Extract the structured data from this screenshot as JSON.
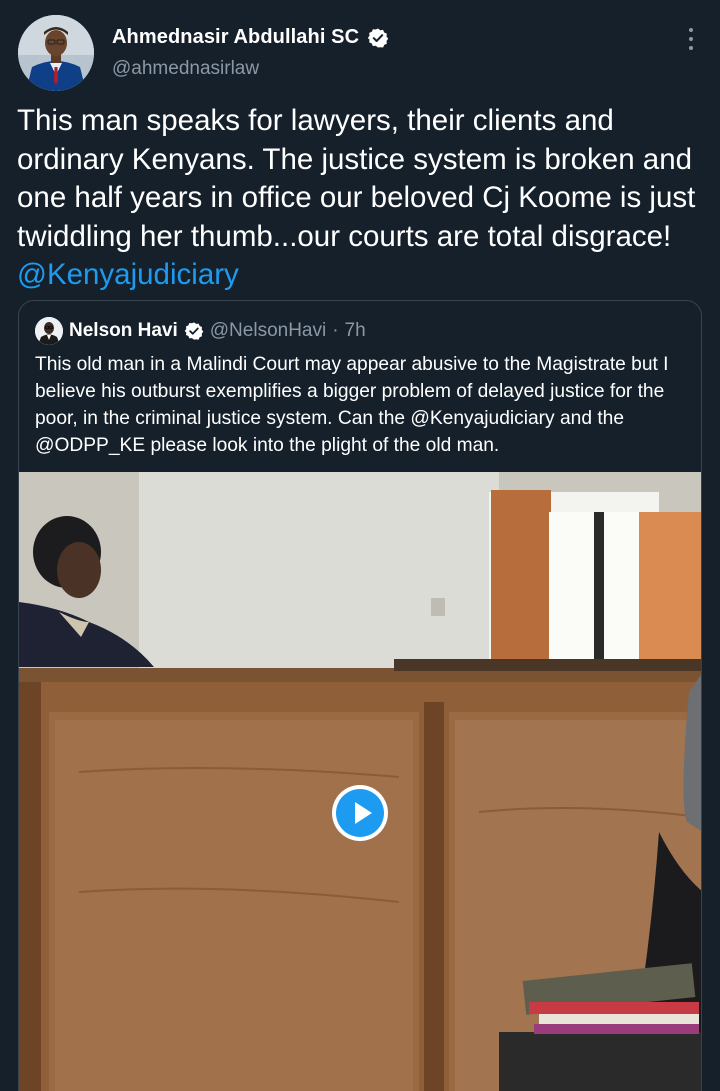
{
  "author": {
    "name": "Ahmednasir Abdullahi SC",
    "handle": "@ahmednasirlaw",
    "verified": true
  },
  "tweet": {
    "text": "This man speaks for lawyers, their clients and ordinary Kenyans. The justice system is broken and one half years in office our beloved Cj Koome is just twiddling her thumb...our courts are total disgrace! ",
    "mention": "@Kenyajudiciary"
  },
  "quote": {
    "name": "Nelson Havi",
    "handle": "@NelsonHavi",
    "separator": "·",
    "time": "7h",
    "text_part1": "This old man in a Malindi Court may appear abusive to the Magistrate but I believe his outburst exemplifies a bigger problem of delayed justice for the poor, in the criminal justice system. Can the ",
    "mention1": "@Kenyajudiciary",
    "text_part2": " and the ",
    "mention2": "@ODPP_KE",
    "text_part3": " please look into the plight of the old man."
  },
  "colors": {
    "background": "#15202b",
    "link": "#1d9bf0",
    "secondary_text": "#8b98a5",
    "border": "#38444d"
  },
  "icons": {
    "verified": "verified-badge-icon",
    "more": "more-options-icon",
    "play": "play-icon"
  }
}
